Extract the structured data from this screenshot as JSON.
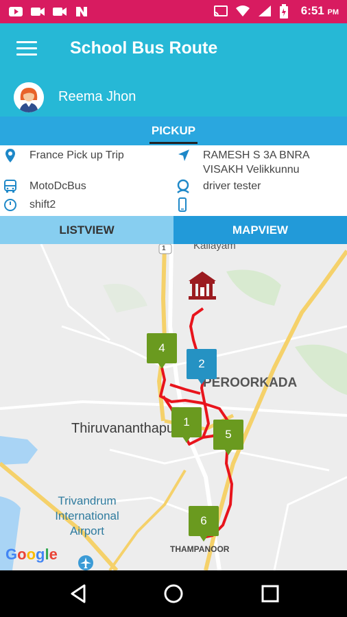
{
  "status_bar": {
    "time": "6:51",
    "ampm": "PM"
  },
  "app": {
    "title": "School Bus Route"
  },
  "user": {
    "name": "Reema Jhon"
  },
  "pickup_tab": "PICKUP",
  "info": {
    "trip": "France Pick up Trip",
    "address_line1": "RAMESH S 3A BNRA",
    "address_line2": "VISAKH Velikkunnu",
    "bus": "MotoDcBus",
    "driver": "driver tester",
    "shift": "shift2",
    "phone": ""
  },
  "view_tabs": {
    "list": "LISTVIEW",
    "map": "MAPVIEW"
  },
  "map": {
    "labels": {
      "kallayam": "Kallayam",
      "peroorkada": "PEROORKADA",
      "city": "Thiruvananthapuram",
      "airport": "Trivandrum International Airport",
      "thampanoor": "THAMPANOOR",
      "road_number": "1",
      "google": "Google"
    },
    "markers": [
      "4",
      "2",
      "1",
      "5",
      "6"
    ],
    "colors": {
      "stop": "#6a9a1f",
      "current": "#2592c3",
      "route": "#e8141c",
      "school": "#9b1b20"
    }
  }
}
